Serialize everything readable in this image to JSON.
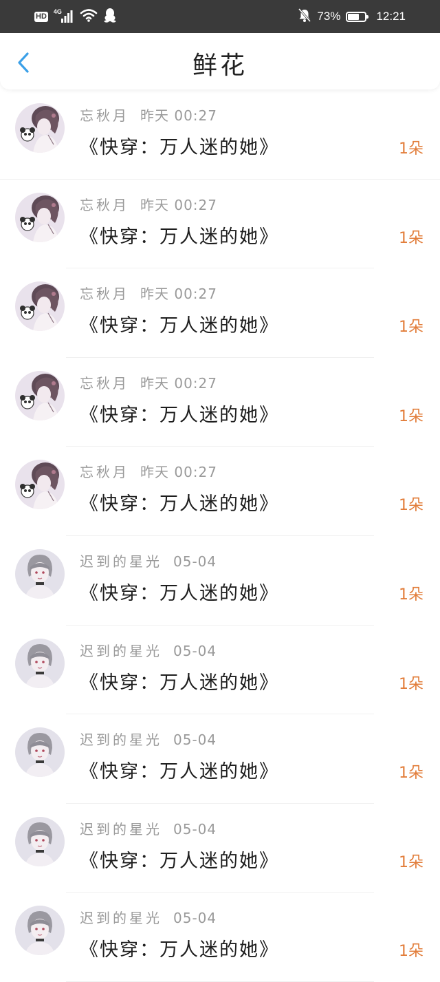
{
  "status_bar": {
    "hd": "HD",
    "network": "4G",
    "battery_pct": "73%",
    "battery_level": 0.73,
    "time": "12:21"
  },
  "header": {
    "title": "鲜花"
  },
  "colors": {
    "accent_blue": "#3ba0e8",
    "count_orange": "#e27d3a"
  },
  "rows": [
    {
      "name": "忘秋月",
      "time": "昨天 00:27",
      "book": "《快穿：万人迷的她》",
      "count": "1朵",
      "avatar": "girl"
    },
    {
      "name": "忘秋月",
      "time": "昨天 00:27",
      "book": "《快穿：万人迷的她》",
      "count": "1朵",
      "avatar": "girl"
    },
    {
      "name": "忘秋月",
      "time": "昨天 00:27",
      "book": "《快穿：万人迷的她》",
      "count": "1朵",
      "avatar": "girl"
    },
    {
      "name": "忘秋月",
      "time": "昨天 00:27",
      "book": "《快穿：万人迷的她》",
      "count": "1朵",
      "avatar": "girl"
    },
    {
      "name": "忘秋月",
      "time": "昨天 00:27",
      "book": "《快穿：万人迷的她》",
      "count": "1朵",
      "avatar": "girl"
    },
    {
      "name": "迟到的星光",
      "time": "05-04",
      "book": "《快穿：万人迷的她》",
      "count": "1朵",
      "avatar": "boy"
    },
    {
      "name": "迟到的星光",
      "time": "05-04",
      "book": "《快穿：万人迷的她》",
      "count": "1朵",
      "avatar": "boy"
    },
    {
      "name": "迟到的星光",
      "time": "05-04",
      "book": "《快穿：万人迷的她》",
      "count": "1朵",
      "avatar": "boy"
    },
    {
      "name": "迟到的星光",
      "time": "05-04",
      "book": "《快穿：万人迷的她》",
      "count": "1朵",
      "avatar": "boy"
    },
    {
      "name": "迟到的星光",
      "time": "05-04",
      "book": "《快穿：万人迷的她》",
      "count": "1朵",
      "avatar": "boy"
    }
  ]
}
